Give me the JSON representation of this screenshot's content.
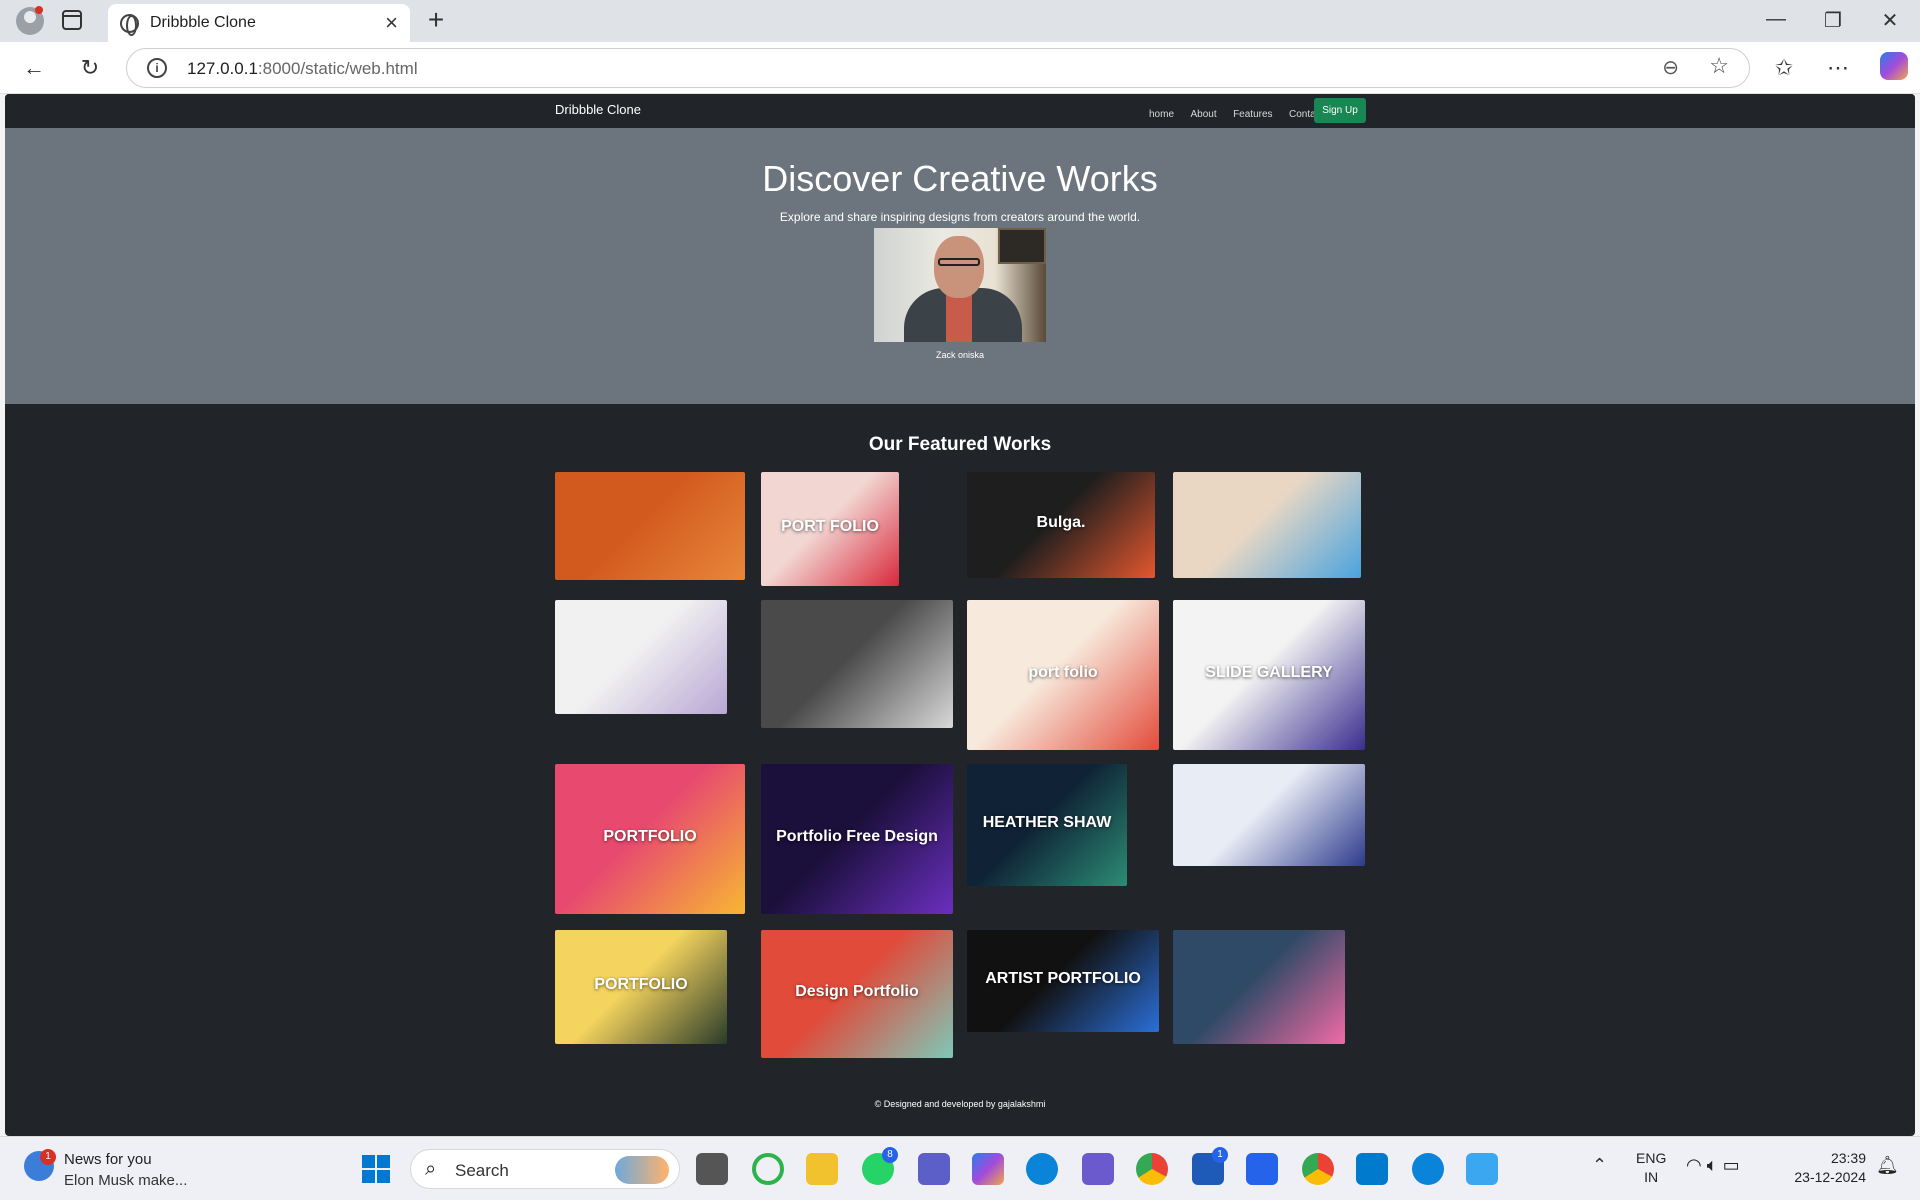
{
  "browser": {
    "tab_title": "Dribbble Clone",
    "url_host": "127.0.0.1",
    "url_rest": ":8000/static/web.html"
  },
  "site": {
    "brand": "Dribbble Clone",
    "nav": [
      "home",
      "About",
      "Features",
      "Contact"
    ],
    "signup_label": "Sign Up",
    "hero_title": "Discover Creative Works",
    "hero_subtitle": "Explore and share inspiring designs from creators around the world.",
    "hero_caption": "Zack oniska",
    "featured_heading": "Our Featured Works",
    "footer": "© Designed and developed by gajalakshmi",
    "works": [
      {
        "label": "",
        "colors": [
          "#d35a1f",
          "#e8873a"
        ]
      },
      {
        "label": "PORT FOLIO",
        "colors": [
          "#f2d6d2",
          "#d9283b"
        ]
      },
      {
        "label": "Bulga.",
        "colors": [
          "#1e1e1e",
          "#e4572e"
        ]
      },
      {
        "label": "",
        "colors": [
          "#e9d7c4",
          "#4aa3df"
        ]
      },
      {
        "label": "",
        "colors": [
          "#f1f1f1",
          "#b8a7d4"
        ]
      },
      {
        "label": "",
        "colors": [
          "#4a4a4a",
          "#d9d9d9"
        ]
      },
      {
        "label": "port folio",
        "colors": [
          "#f7e9dc",
          "#e34b3c"
        ]
      },
      {
        "label": "SLIDE GALLERY",
        "colors": [
          "#f3f3f3",
          "#3a2d8f"
        ]
      },
      {
        "label": "PORTFOLIO",
        "colors": [
          "#e84a6f",
          "#f7b733"
        ]
      },
      {
        "label": "Portfolio Free Design",
        "colors": [
          "#1b0f3b",
          "#6b2fbf"
        ]
      },
      {
        "label": "HEATHER SHAW",
        "colors": [
          "#0f2236",
          "#2c8c74"
        ]
      },
      {
        "label": "",
        "colors": [
          "#e8ecf5",
          "#2d3a8c"
        ]
      },
      {
        "label": "PORTFOLIO",
        "colors": [
          "#f4d35e",
          "#2a3b2a"
        ]
      },
      {
        "label": "Design Portfolio",
        "colors": [
          "#e04b3a",
          "#7ec8b8"
        ]
      },
      {
        "label": "ARTIST PORTFOLIO",
        "colors": [
          "#111111",
          "#2b6fd8"
        ]
      },
      {
        "label": "",
        "colors": [
          "#2f4a66",
          "#f06aa5"
        ]
      }
    ]
  },
  "taskbar": {
    "news_title": "News for you",
    "news_sub": "Elon Musk make...",
    "news_badge": "1",
    "search_placeholder": "Search",
    "badge_whatsapp": "8",
    "badge_l": "1",
    "lang_1": "ENG",
    "lang_2": "IN",
    "time": "23:39",
    "date": "23-12-2024"
  }
}
